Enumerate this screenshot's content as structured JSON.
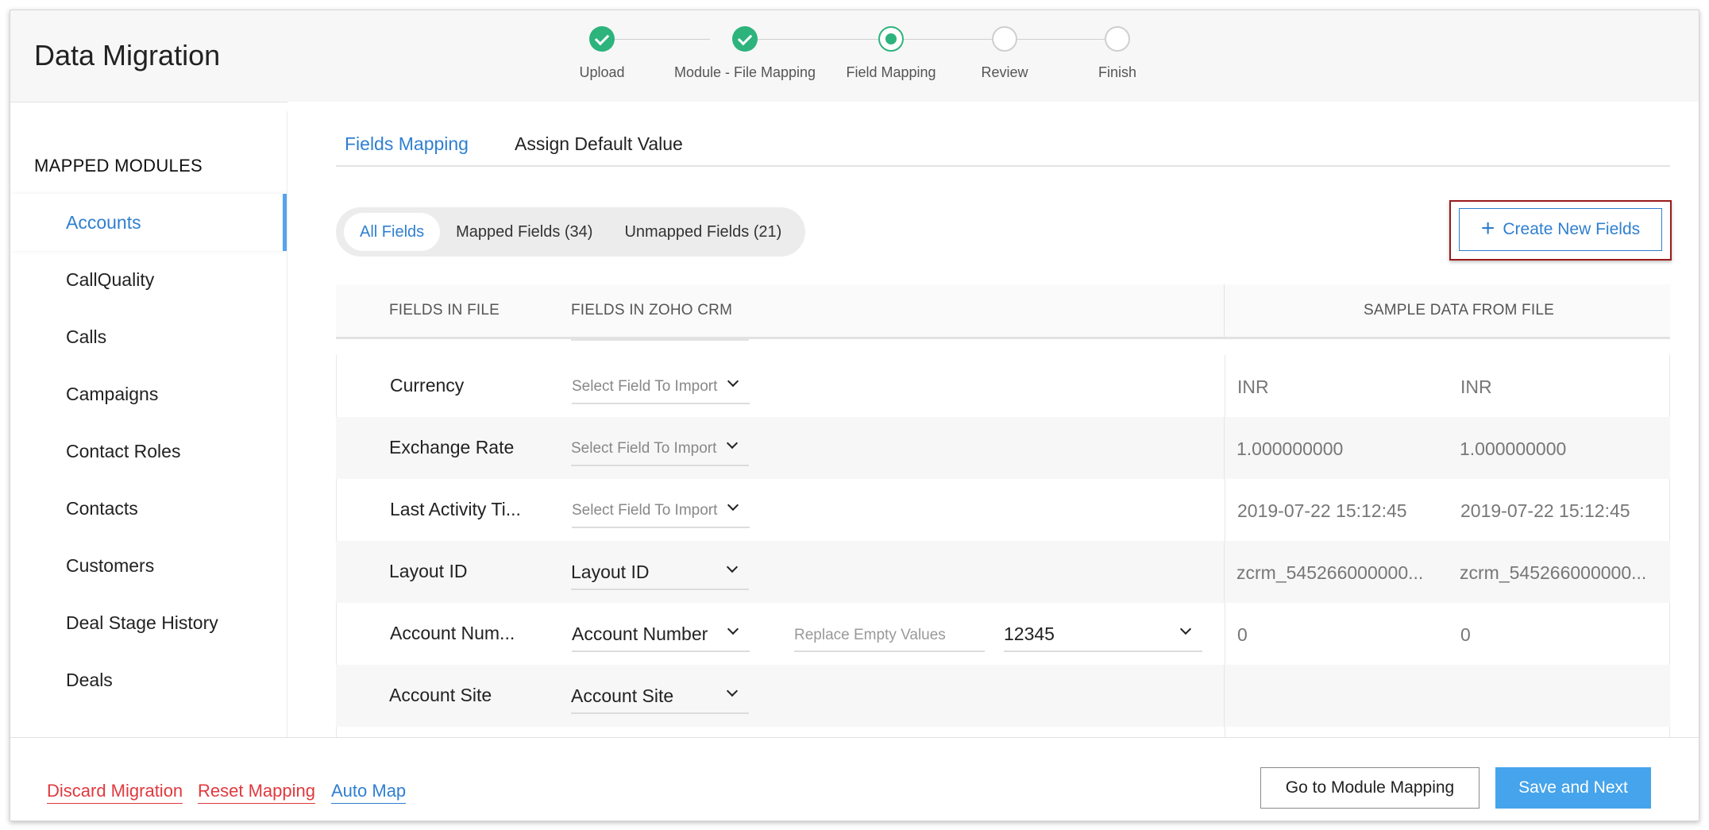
{
  "header": {
    "title": "Data Migration",
    "steps": [
      {
        "label": "Upload",
        "state": "done"
      },
      {
        "label": "Module - File Mapping",
        "state": "done"
      },
      {
        "label": "Field Mapping",
        "state": "current"
      },
      {
        "label": "Review",
        "state": "todo"
      },
      {
        "label": "Finish",
        "state": "todo"
      }
    ],
    "accent_color": "#2db37c"
  },
  "sidebar": {
    "title": "MAPPED MODULES",
    "items": [
      {
        "label": "Accounts",
        "active": true
      },
      {
        "label": "CallQuality"
      },
      {
        "label": "Calls"
      },
      {
        "label": "Campaigns"
      },
      {
        "label": "Contact Roles"
      },
      {
        "label": "Contacts"
      },
      {
        "label": "Customers"
      },
      {
        "label": "Deal Stage History"
      },
      {
        "label": "Deals"
      }
    ]
  },
  "tabs": {
    "fields_mapping": "Fields Mapping",
    "assign_default": "Assign Default Value"
  },
  "filters": {
    "all": "All Fields",
    "mapped": "Mapped Fields (34)",
    "unmapped": "Unmapped Fields (21)"
  },
  "create_button": {
    "label": "Create New Fields"
  },
  "table": {
    "headers": {
      "file": "FIELDS IN FILE",
      "crm": "FIELDS IN ZOHO CRM",
      "sample": "SAMPLE DATA FROM FILE"
    },
    "rows": [
      {
        "file": "Currency",
        "crm": "Select Field To Import",
        "placeholder": true,
        "s1": "INR",
        "s2": "INR"
      },
      {
        "file": "Exchange Rate",
        "crm": "Select Field To Import",
        "placeholder": true,
        "s1": "1.000000000",
        "s2": "1.000000000"
      },
      {
        "file": "Last Activity Ti...",
        "crm": "Select Field To Import",
        "placeholder": true,
        "s1": "2019-07-22 15:12:45",
        "s2": "2019-07-22 15:12:45"
      },
      {
        "file": "Layout ID",
        "crm": "Layout ID",
        "placeholder": false,
        "s1": "zcrm_545266000000...",
        "s2": "zcrm_545266000000..."
      },
      {
        "file": "Account Num...",
        "crm": "Account Number",
        "placeholder": false,
        "replace_placeholder": "Replace Empty Values",
        "replace_value": "12345",
        "s1": "0",
        "s2": "0"
      },
      {
        "file": "Account Site",
        "crm": "Account Site",
        "placeholder": false,
        "s1": "",
        "s2": ""
      }
    ]
  },
  "footer": {
    "discard": "Discard Migration",
    "reset": "Reset Mapping",
    "automap": "Auto Map",
    "go_module": "Go to Module Mapping",
    "save_next": "Save and Next"
  }
}
